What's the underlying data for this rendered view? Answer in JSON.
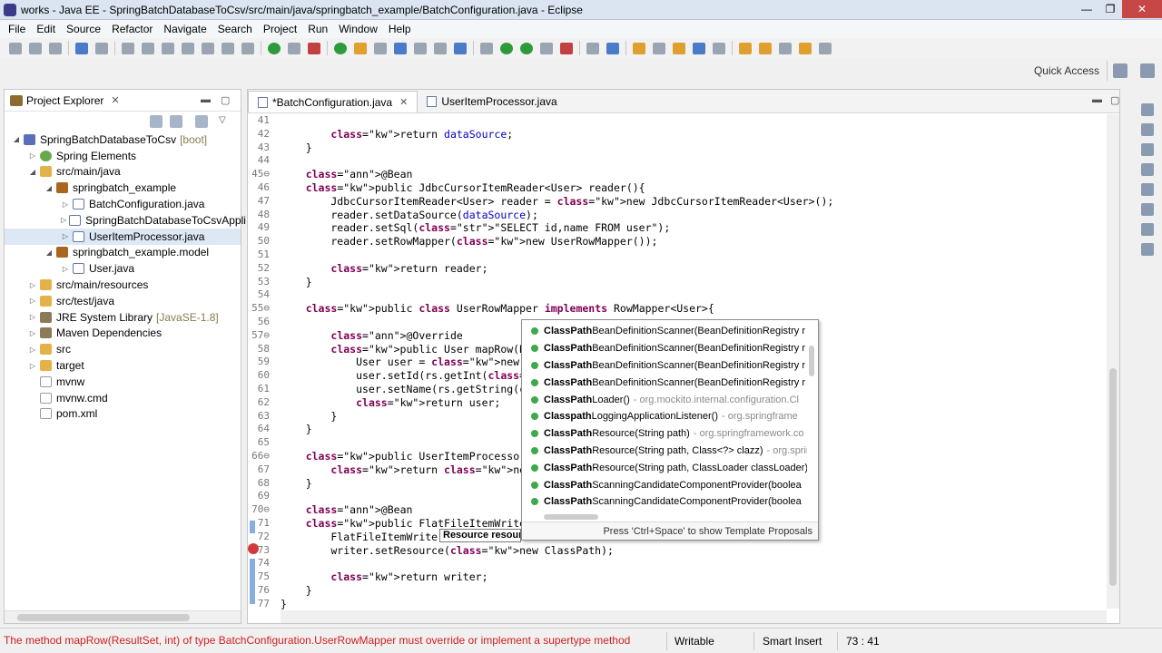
{
  "window": {
    "title": "works - Java EE - SpringBatchDatabaseToCsv/src/main/java/springbatch_example/BatchConfiguration.java - Eclipse",
    "minimize": "—",
    "maximize": "❐",
    "close": "✕"
  },
  "menu": [
    "File",
    "Edit",
    "Source",
    "Refactor",
    "Navigate",
    "Search",
    "Project",
    "Run",
    "Window",
    "Help"
  ],
  "quick_access": "Quick Access",
  "explorer": {
    "title": "Project Explorer",
    "close": "✕",
    "items": [
      {
        "label": "SpringBatchDatabaseToCsv",
        "suffix": "[boot]",
        "icon": "project-icon",
        "arrow": "◢"
      },
      {
        "label": "Spring Elements",
        "suffix": "",
        "icon": "spring-icon",
        "arrow": "▷"
      },
      {
        "label": "src/main/java",
        "suffix": "",
        "icon": "source-folder-icon",
        "arrow": "◢"
      },
      {
        "label": "springbatch_example",
        "suffix": "",
        "icon": "package-icon",
        "arrow": "◢"
      },
      {
        "label": "BatchConfiguration.java",
        "suffix": "",
        "icon": "java-file-icon",
        "arrow": "▷"
      },
      {
        "label": "SpringBatchDatabaseToCsvAppli",
        "suffix": "",
        "icon": "java-file-icon",
        "arrow": "▷"
      },
      {
        "label": "UserItemProcessor.java",
        "suffix": "",
        "icon": "java-file-icon",
        "arrow": "▷"
      },
      {
        "label": "springbatch_example.model",
        "suffix": "",
        "icon": "package-icon",
        "arrow": "◢"
      },
      {
        "label": "User.java",
        "suffix": "",
        "icon": "java-file-icon",
        "arrow": "▷"
      },
      {
        "label": "src/main/resources",
        "suffix": "",
        "icon": "source-folder-icon",
        "arrow": "▷"
      },
      {
        "label": "src/test/java",
        "suffix": "",
        "icon": "source-folder-icon",
        "arrow": "▷"
      },
      {
        "label": "JRE System Library",
        "suffix": "[JavaSE-1.8]",
        "icon": "library-icon",
        "arrow": "▷"
      },
      {
        "label": "Maven Dependencies",
        "suffix": "",
        "icon": "library-icon",
        "arrow": "▷"
      },
      {
        "label": "src",
        "suffix": "",
        "icon": "folder-icon",
        "arrow": "▷"
      },
      {
        "label": "target",
        "suffix": "",
        "icon": "folder-icon",
        "arrow": "▷"
      },
      {
        "label": "mvnw",
        "suffix": "",
        "icon": "file-icon",
        "arrow": ""
      },
      {
        "label": "mvnw.cmd",
        "suffix": "",
        "icon": "file-icon",
        "arrow": ""
      },
      {
        "label": "pom.xml",
        "suffix": "",
        "icon": "file-icon",
        "arrow": ""
      }
    ]
  },
  "editor": {
    "tabs": [
      {
        "label": "*BatchConfiguration.java",
        "close": "✕"
      },
      {
        "label": "UserItemProcessor.java",
        "close": ""
      }
    ],
    "lines": [
      {
        "n": "41",
        "code": ""
      },
      {
        "n": "42",
        "code": "        return dataSource;"
      },
      {
        "n": "43",
        "code": "    }"
      },
      {
        "n": "44",
        "code": ""
      },
      {
        "n": "45⊖",
        "code": "    @Bean"
      },
      {
        "n": "46",
        "code": "    public JdbcCursorItemReader<User> reader(){"
      },
      {
        "n": "47",
        "code": "        JdbcCursorItemReader<User> reader = new JdbcCursorItemReader<User>();"
      },
      {
        "n": "48",
        "code": "        reader.setDataSource(dataSource);"
      },
      {
        "n": "49",
        "code": "        reader.setSql(\"SELECT id,name FROM user\");"
      },
      {
        "n": "50",
        "code": "        reader.setRowMapper(new UserRowMapper());"
      },
      {
        "n": "51",
        "code": ""
      },
      {
        "n": "52",
        "code": "        return reader;"
      },
      {
        "n": "53",
        "code": "    }"
      },
      {
        "n": "54",
        "code": ""
      },
      {
        "n": "55⊖",
        "code": "    public class UserRowMapper implements RowMapper<User>{"
      },
      {
        "n": "56",
        "code": ""
      },
      {
        "n": "57⊖",
        "code": "        @Override"
      },
      {
        "n": "58",
        "code": "        public User mapRow(ResultSet rs,"
      },
      {
        "n": "59",
        "code": "            User user = new User();"
      },
      {
        "n": "60",
        "code": "            user.setId(rs.getInt(\"id\"));"
      },
      {
        "n": "61",
        "code": "            user.setName(rs.getString(\"n"
      },
      {
        "n": "62",
        "code": "            return user;"
      },
      {
        "n": "63",
        "code": "        }"
      },
      {
        "n": "64",
        "code": "    }"
      },
      {
        "n": "65",
        "code": ""
      },
      {
        "n": "66⊖",
        "code": "    public UserItemProcessor processor()"
      },
      {
        "n": "67",
        "code": "        return new UserItemProcessor();"
      },
      {
        "n": "68",
        "code": "    }"
      },
      {
        "n": "69",
        "code": ""
      },
      {
        "n": "70⊖",
        "code": "    @Bean"
      },
      {
        "n": "71",
        "code": "    public FlatFileItemWriter<User> writ"
      },
      {
        "n": "72",
        "code": "        FlatFileItemWriter<"
      },
      {
        "n": "73",
        "code": "        writer.setResource(new ClassPath);"
      },
      {
        "n": "74",
        "code": ""
      },
      {
        "n": "75",
        "code": "        return writer;"
      },
      {
        "n": "76",
        "code": "    }"
      },
      {
        "n": "77",
        "code": "}"
      }
    ],
    "hover_text": "Resource resour"
  },
  "completion": {
    "items": [
      {
        "name": "ClassPath",
        "rest": "BeanDefinitionScanner(BeanDefinitionRegistry r",
        "pkg": ""
      },
      {
        "name": "ClassPath",
        "rest": "BeanDefinitionScanner(BeanDefinitionRegistry r",
        "pkg": ""
      },
      {
        "name": "ClassPath",
        "rest": "BeanDefinitionScanner(BeanDefinitionRegistry r",
        "pkg": ""
      },
      {
        "name": "ClassPath",
        "rest": "BeanDefinitionScanner(BeanDefinitionRegistry r",
        "pkg": ""
      },
      {
        "name": "ClassPath",
        "rest": "Loader()",
        "pkg": "- org.mockito.internal.configuration.Cl"
      },
      {
        "name": "Classpath",
        "rest": "LoggingApplicationListener()",
        "pkg": "- org.springframe"
      },
      {
        "name": "ClassPath",
        "rest": "Resource(String path)",
        "pkg": "- org.springframework.co"
      },
      {
        "name": "ClassPath",
        "rest": "Resource(String path, Class<?> clazz)",
        "pkg": "- org.sprir"
      },
      {
        "name": "ClassPath",
        "rest": "Resource(String path, ClassLoader classLoader)",
        "pkg": ""
      },
      {
        "name": "ClassPath",
        "rest": "ScanningCandidateComponentProvider(boolea",
        "pkg": ""
      },
      {
        "name": "ClassPath",
        "rest": "ScanningCandidateComponentProvider(boolea",
        "pkg": ""
      }
    ],
    "footer": "Press 'Ctrl+Space' to show Template Proposals"
  },
  "status": {
    "message": "The method mapRow(ResultSet, int) of type BatchConfiguration.UserRowMapper must override or implement a supertype method",
    "writable": "Writable",
    "insert_mode": "Smart Insert",
    "position": "73 : 41"
  }
}
